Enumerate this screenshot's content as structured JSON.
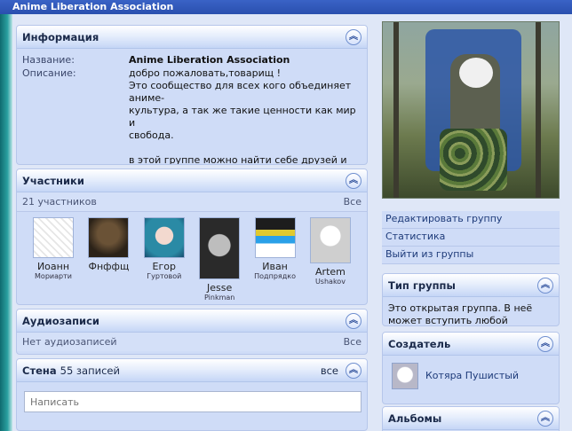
{
  "window": {
    "title": "Anime Liberation Association"
  },
  "info_panel": {
    "title": "Информация",
    "name_label": "Название:",
    "name_value": "Anime Liberation Association",
    "desc_label": "Описание:",
    "desc_value": "добро пожаловать,товарищ !\nЭто сообщество для всех кого объединяет аниме-\nкультура, а так же такие ценности как мир и\nсвобода.\n\nв этой группе можно найти себе друзей и\nединомышленников,\nня кавай =)"
  },
  "members_panel": {
    "title": "Участники",
    "count": "21 участников",
    "all_link": "Все",
    "members": [
      {
        "name": "Иоанн",
        "sub": "Мориарти"
      },
      {
        "name": "Фнффщ",
        "sub": ""
      },
      {
        "name": "Егор",
        "sub": "Гуртовой"
      },
      {
        "name": "Jesse",
        "sub": "Pinkman"
      },
      {
        "name": "Иван",
        "sub": "Подпрядко"
      },
      {
        "name": "Artem",
        "sub": "Ushakov"
      }
    ]
  },
  "audio_panel": {
    "title": "Аудиозаписи",
    "empty": "Нет аудиозаписей",
    "all_link": "Все"
  },
  "wall_panel": {
    "title": "Стена",
    "count": "55 записей",
    "all_link": "все",
    "input_placeholder": "Написать"
  },
  "actions": [
    "Редактировать группу",
    "Статистика",
    "Выйти из группы"
  ],
  "group_type_panel": {
    "title": "Тип группы",
    "text": "Это открытая группа. В неё может вступить любой желающий."
  },
  "creator_panel": {
    "title": "Создатель",
    "name": "Котяра Пушистый"
  },
  "albums_panel": {
    "title": "Альбомы"
  },
  "colors": {
    "header_bar": "#2a4fae",
    "panel_bg": "#cfdcf7",
    "link": "#1e3b7a"
  },
  "icons": {
    "collapse": "chevron-up-double-icon"
  }
}
